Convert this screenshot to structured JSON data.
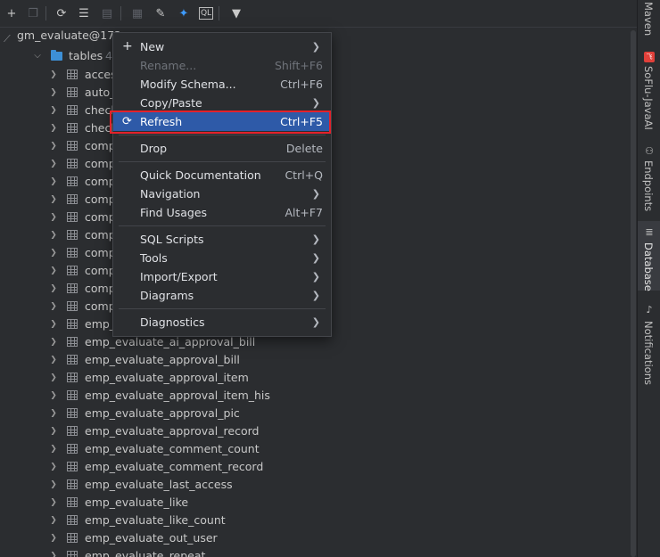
{
  "toolbar": {
    "icons": [
      "add-icon",
      "duplicate-icon",
      "refresh-icon",
      "edit-datasource-icon",
      "properties-icon",
      "table-icon",
      "edit-icon",
      "jump-to-console-icon",
      "console-icon",
      "filter-icon"
    ]
  },
  "tree": {
    "connection": "gm_evaluate@172",
    "tables_folder": {
      "label": "tables",
      "count": "4"
    },
    "rows": [
      "acces",
      "auto_",
      "check",
      "check",
      "comp",
      "comp",
      "comp",
      "comp",
      "comp",
      "comp",
      "comp",
      "comp",
      "comp",
      "comp",
      "emp_",
      "emp_evaluate_ai_approval_bill",
      "emp_evaluate_approval_bill",
      "emp_evaluate_approval_item",
      "emp_evaluate_approval_item_his",
      "emp_evaluate_approval_pic",
      "emp_evaluate_approval_record",
      "emp_evaluate_comment_count",
      "emp_evaluate_comment_record",
      "emp_evaluate_last_access",
      "emp_evaluate_like",
      "emp_evaluate_like_count",
      "emp_evaluate_out_user",
      "emp_evaluate_repeat"
    ]
  },
  "context_menu": {
    "new": {
      "prefix": "+",
      "label": "New"
    },
    "rename": {
      "label": "Rename...",
      "shortcut": "Shift+F6"
    },
    "modify_schema": {
      "label": "Modify Schema...",
      "shortcut": "Ctrl+F6"
    },
    "copy_paste": {
      "label": "Copy/Paste"
    },
    "refresh": {
      "label": "Refresh",
      "shortcut": "Ctrl+F5"
    },
    "drop": {
      "label": "Drop",
      "shortcut": "Delete"
    },
    "quick_doc": {
      "label": "Quick Documentation",
      "shortcut": "Ctrl+Q"
    },
    "navigation": {
      "label": "Navigation"
    },
    "find_usages": {
      "label": "Find Usages",
      "shortcut": "Alt+F7"
    },
    "sql_scripts": {
      "label": "SQL Scripts"
    },
    "tools": {
      "label": "Tools"
    },
    "import_export": {
      "label": "Import/Export"
    },
    "diagrams": {
      "label": "Diagrams"
    },
    "diagnostics": {
      "label": "Diagnostics"
    }
  },
  "right_strip": {
    "maven": "Maven",
    "sofiu": "SoFlu-JavaAI",
    "endpoints": "Endpoints",
    "database": "Database",
    "notifications": "Notifications"
  },
  "colors": {
    "selection": "#2e5aa8",
    "highlight_box": "#e3222b",
    "folder": "#3d8fd6"
  }
}
